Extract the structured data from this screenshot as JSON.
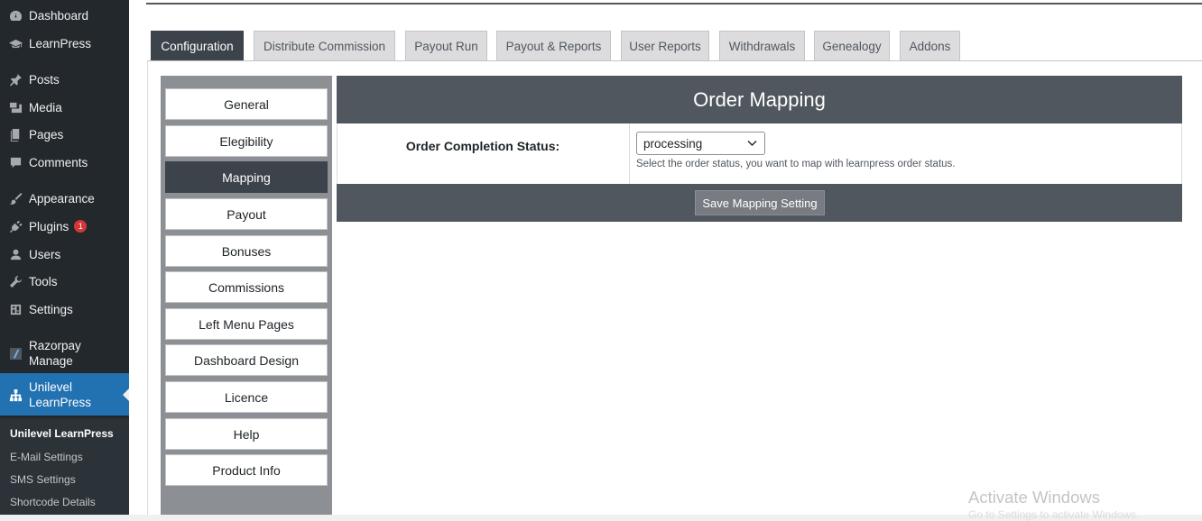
{
  "sidebar": {
    "items": [
      {
        "label": "Dashboard",
        "icon": "dashboard-icon"
      },
      {
        "label": "LearnPress",
        "icon": "graduation-cap-icon"
      },
      {
        "label": "Posts",
        "icon": "pin-icon"
      },
      {
        "label": "Media",
        "icon": "media-icon"
      },
      {
        "label": "Pages",
        "icon": "pages-icon"
      },
      {
        "label": "Comments",
        "icon": "comment-icon"
      },
      {
        "label": "Appearance",
        "icon": "brush-icon"
      },
      {
        "label": "Plugins",
        "icon": "plugin-icon",
        "badge": "1"
      },
      {
        "label": "Users",
        "icon": "user-icon"
      },
      {
        "label": "Tools",
        "icon": "wrench-icon"
      },
      {
        "label": "Settings",
        "icon": "settings-icon"
      },
      {
        "label": "Razorpay\nManage",
        "icon": "razorpay-icon"
      },
      {
        "label": "Unilevel\nLearnPress",
        "icon": "network-icon"
      }
    ],
    "submenu": [
      "Unilevel LearnPress",
      "E-Mail Settings",
      "SMS Settings",
      "Shortcode Details"
    ]
  },
  "tabs": [
    "Configuration",
    "Distribute Commission",
    "Payout Run",
    "Payout & Reports",
    "User Reports",
    "Withdrawals",
    "Genealogy",
    "Addons"
  ],
  "config_menu": [
    "General",
    "Elegibility",
    "Mapping",
    "Payout",
    "Bonuses",
    "Commissions",
    "Left Menu Pages",
    "Dashboard Design",
    "Licence",
    "Help",
    "Product Info"
  ],
  "mapping": {
    "title": "Order Mapping",
    "field_label": "Order Completion Status:",
    "select_value": "processing",
    "help_text": "Select the order status, you want to map with learnpress order status.",
    "save_label": "Save Mapping Setting"
  },
  "watermark": {
    "title": "Activate Windows",
    "subtitle": "Go to Settings to activate Windows."
  },
  "colors": {
    "sidebar_bg": "#23282d",
    "active_menu": "#2271b1",
    "header_bar": "#50575e",
    "badge": "#d63638"
  }
}
